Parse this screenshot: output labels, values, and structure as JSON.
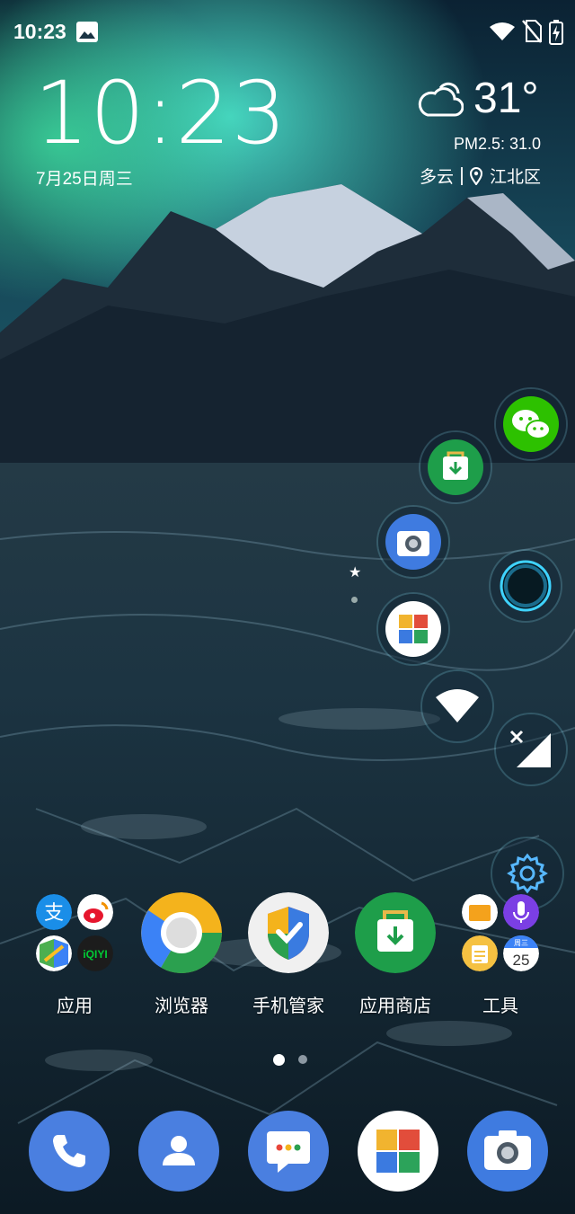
{
  "status_bar": {
    "time": "10:23",
    "icons": [
      "gallery-icon",
      "wifi-icon",
      "no-sim-icon",
      "battery-charging-icon"
    ]
  },
  "clock_widget": {
    "time": "10:23",
    "date": "7月25日周三",
    "temperature": "31°",
    "pm25": "PM2.5: 31.0",
    "condition": "多云",
    "location": "江北区",
    "icons": [
      "cloud-icon",
      "location-pin-icon"
    ]
  },
  "floating_shortcuts": [
    {
      "name": "wechat",
      "icon": "wechat-icon"
    },
    {
      "name": "app-store",
      "icon": "shopping-bag-download-icon"
    },
    {
      "name": "camera",
      "icon": "camera-icon"
    },
    {
      "name": "assistant",
      "icon": "assistant-orb-icon"
    },
    {
      "name": "photos",
      "icon": "pinwheel-photos-icon"
    },
    {
      "name": "wifi-toggle",
      "icon": "wifi-icon"
    },
    {
      "name": "mobile-data-toggle",
      "icon": "signal-off-icon"
    },
    {
      "name": "settings",
      "icon": "gear-icon"
    }
  ],
  "home_apps": [
    {
      "label": "应用",
      "icon": "app-folder-icon"
    },
    {
      "label": "浏览器",
      "icon": "browser-icon"
    },
    {
      "label": "手机管家",
      "icon": "phone-manager-shield-icon"
    },
    {
      "label": "应用商店",
      "icon": "app-store-icon"
    },
    {
      "label": "工具",
      "icon": "tools-folder-icon"
    }
  ],
  "folder_contents": {
    "apps": [
      "alipay-icon",
      "weibo-icon",
      "maps-icon",
      "iqiyi-icon"
    ],
    "iqiyi_text": "iQIYI",
    "tools": [
      "files-icon",
      "recorder-icon",
      "notes-icon",
      "calendar-icon"
    ],
    "calendar_day": "25",
    "calendar_weekday": "周三"
  },
  "page_indicator": {
    "pages": 2,
    "current": 1
  },
  "dock": [
    {
      "name": "phone",
      "icon": "phone-icon"
    },
    {
      "name": "contacts",
      "icon": "contacts-icon"
    },
    {
      "name": "messages",
      "icon": "message-icon"
    },
    {
      "name": "photos",
      "icon": "pinwheel-photos-icon"
    },
    {
      "name": "camera",
      "icon": "camera-icon"
    }
  ],
  "colors": {
    "wechat_green": "#2dc100",
    "store_green": "#1e9e4a",
    "dock_blue": "#4a7fe0",
    "aurora": "#38d6b8"
  }
}
